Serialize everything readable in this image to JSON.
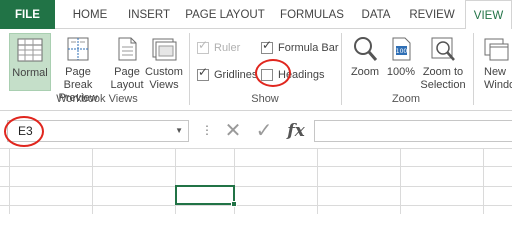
{
  "tabs": [
    {
      "label": "FILE"
    },
    {
      "label": "HOME"
    },
    {
      "label": "INSERT"
    },
    {
      "label": "PAGE LAYOUT"
    },
    {
      "label": "FORMULAS"
    },
    {
      "label": "DATA"
    },
    {
      "label": "REVIEW"
    },
    {
      "label": "VIEW"
    }
  ],
  "workbook_views": {
    "group_label": "Workbook Views",
    "buttons": [
      {
        "line1": "Normal",
        "line2": "",
        "icon": "normal-view-icon",
        "selected": true
      },
      {
        "line1": "Page Break",
        "line2": "Preview",
        "icon": "page-break-preview-icon"
      },
      {
        "line1": "Page",
        "line2": "Layout",
        "icon": "page-layout-icon"
      },
      {
        "line1": "Custom",
        "line2": "Views",
        "icon": "custom-views-icon"
      }
    ]
  },
  "show": {
    "group_label": "Show",
    "items": [
      {
        "label": "Ruler",
        "checked": true,
        "disabled": true
      },
      {
        "label": "Formula Bar",
        "checked": true,
        "disabled": false
      },
      {
        "label": "Gridlines",
        "checked": true,
        "disabled": false
      },
      {
        "label": "Headings",
        "checked": false,
        "disabled": false
      }
    ]
  },
  "zoom": {
    "group_label": "Zoom",
    "buttons": [
      {
        "line1": "Zoom",
        "line2": "",
        "icon": "zoom-magnifier-icon"
      },
      {
        "line1": "100%",
        "line2": "",
        "icon": "zoom-100-icon"
      },
      {
        "line1": "Zoom to",
        "line2": "Selection",
        "icon": "zoom-to-selection-icon"
      }
    ]
  },
  "window": {
    "buttons": [
      {
        "line1": "New",
        "line2": "Window",
        "icon": "new-window-icon"
      }
    ]
  },
  "formula_bar": {
    "name_box": "E3",
    "formula": "",
    "fx_label": "fx"
  },
  "colors": {
    "accent": "#217346",
    "annotation": "#e0261e",
    "selected_button": "#c5dfc9"
  }
}
